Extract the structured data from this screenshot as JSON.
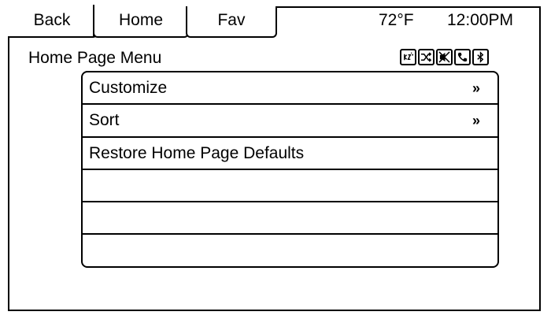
{
  "tabs": {
    "back": "Back",
    "home": "Home",
    "fav": "Fav"
  },
  "status": {
    "temperature": "72°F",
    "time": "12:00PM"
  },
  "page_title": "Home Page Menu",
  "status_icons": [
    "speech-recognition-icon",
    "shuffle-icon",
    "mute-icon",
    "phone-icon",
    "bluetooth-icon"
  ],
  "menu": {
    "items": [
      {
        "label": "Customize",
        "chevron": "»"
      },
      {
        "label": "Sort",
        "chevron": "»"
      },
      {
        "label": "Restore Home Page Defaults",
        "chevron": ""
      },
      {
        "label": "",
        "chevron": ""
      },
      {
        "label": "",
        "chevron": ""
      },
      {
        "label": "",
        "chevron": ""
      }
    ]
  }
}
